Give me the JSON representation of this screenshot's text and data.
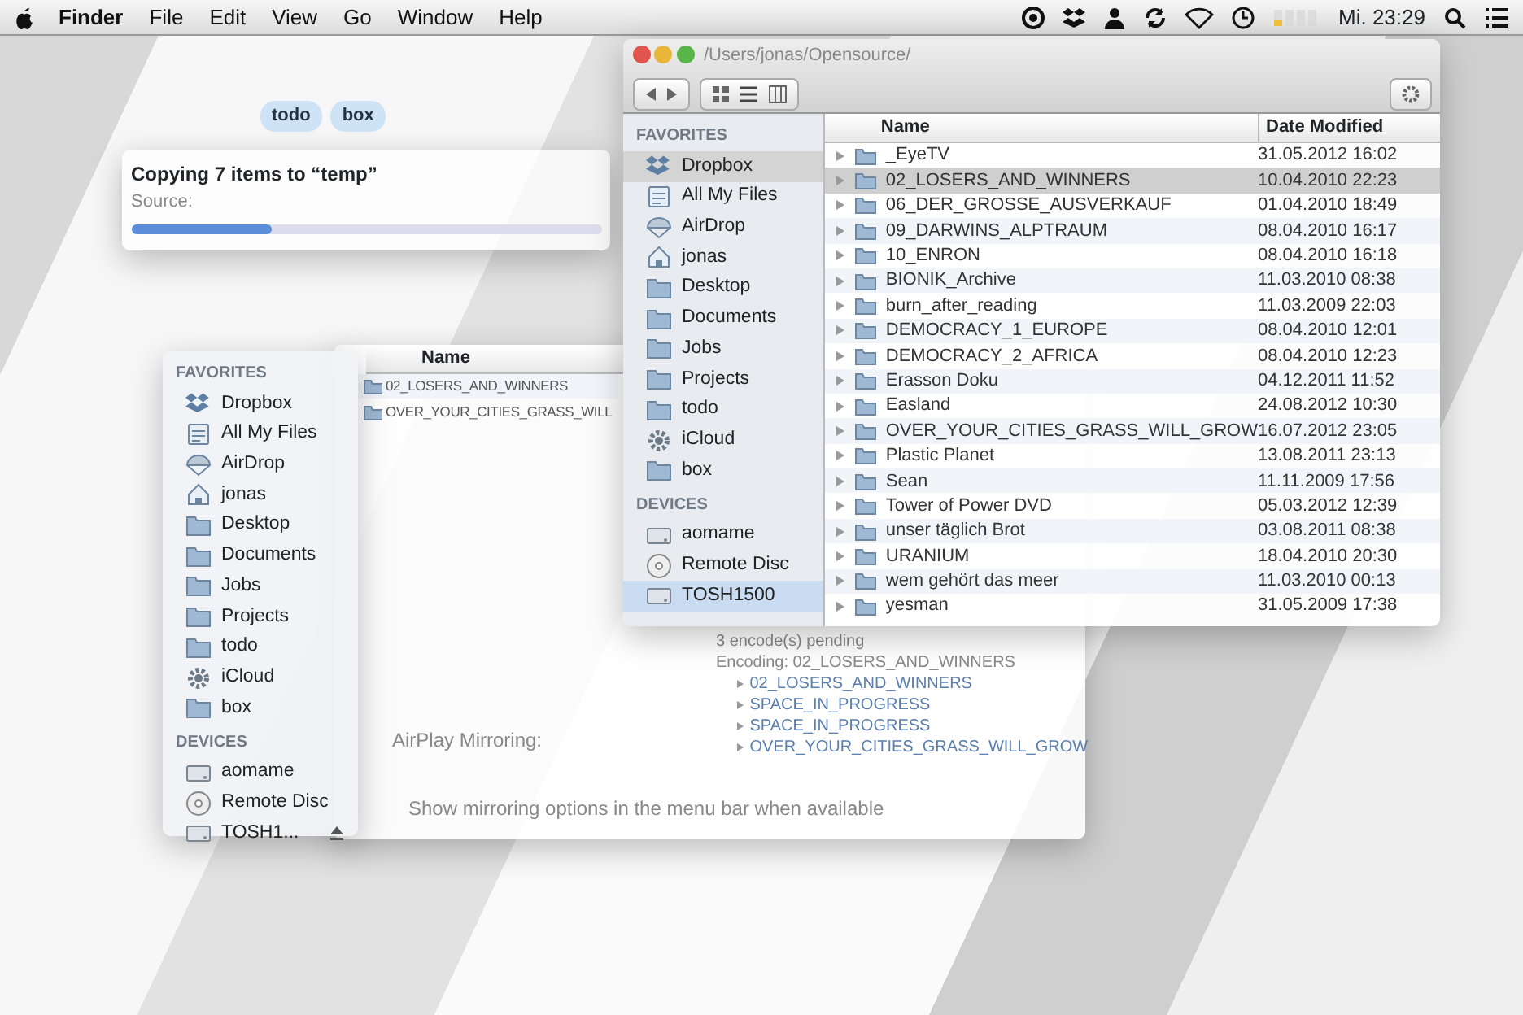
{
  "menu_bar": {
    "items": [
      {
        "label": "Finder",
        "kind": "app"
      },
      {
        "label": "File",
        "kind": "menu"
      },
      {
        "label": "Edit",
        "kind": "menu"
      },
      {
        "label": "View",
        "kind": "menu"
      },
      {
        "label": "Go",
        "kind": "menu"
      },
      {
        "label": "Window",
        "kind": "menu"
      },
      {
        "label": "Help",
        "kind": "menu"
      }
    ],
    "clock": "Mi. 23:29"
  },
  "copy_dialog": {
    "title": "Copying 7 items to “temp”",
    "source_label": "Source:",
    "level": 0.3
  },
  "tags": [
    "todo",
    "box"
  ],
  "left_finder": {
    "sections": [
      {
        "heading": "FAVORITES",
        "items": [
          {
            "label": "Dropbox",
            "kind": "dropbox",
            "selected": false
          },
          {
            "label": "All My Files",
            "kind": "files",
            "selected": false
          },
          {
            "label": "AirDrop",
            "kind": "airdrop",
            "selected": false
          },
          {
            "label": "jonas",
            "kind": "home",
            "selected": false
          },
          {
            "label": "Desktop",
            "kind": "folder",
            "selected": false
          },
          {
            "label": "Documents",
            "kind": "folder",
            "selected": false
          },
          {
            "label": "Jobs",
            "kind": "folder",
            "selected": false
          },
          {
            "label": "Projects",
            "kind": "folder",
            "selected": false
          },
          {
            "label": "todo",
            "kind": "folder",
            "selected": false
          },
          {
            "label": "iCloud",
            "kind": "cloud",
            "selected": false
          },
          {
            "label": "box",
            "kind": "folder",
            "selected": false
          }
        ]
      },
      {
        "heading": "DEVICES",
        "items": [
          {
            "label": "aomame",
            "kind": "disk",
            "selected": false
          },
          {
            "label": "Remote Disc",
            "kind": "disc",
            "selected": false
          },
          {
            "label": "TOSH1...",
            "kind": "ejectable",
            "selected": false
          }
        ]
      }
    ]
  },
  "middle_window": {
    "column": "Name",
    "rows": [
      "02_LOSERS_AND_WINNERS",
      "OVER_YOUR_CITIES_GRASS_WILL"
    ],
    "airplay_label": "AirPlay Mirroring:",
    "airplay_option": "Show mirroring options in the menu bar when available"
  },
  "queue": {
    "status": "3 encode(s) pending",
    "encoding": "Encoding: 02_LOSERS_AND_WINNERS",
    "items": [
      "02_LOSERS_AND_WINNERS",
      "SPACE_IN_PROGRESS",
      "SPACE_IN_PROGRESS",
      "OVER_YOUR_CITIES_GRASS_WILL_GROW"
    ]
  },
  "right_finder": {
    "path": "/Users/jonas/Opensource/",
    "sections": [
      {
        "heading": "FAVORITES",
        "items": [
          {
            "label": "Dropbox",
            "kind": "dropbox",
            "selected": true
          },
          {
            "label": "All My Files",
            "kind": "files",
            "selected": false
          },
          {
            "label": "AirDrop",
            "kind": "airdrop",
            "selected": false
          },
          {
            "label": "jonas",
            "kind": "home",
            "selected": false
          },
          {
            "label": "Desktop",
            "kind": "folder",
            "selected": false
          },
          {
            "label": "Documents",
            "kind": "folder",
            "selected": false
          },
          {
            "label": "Jobs",
            "kind": "folder",
            "selected": false
          },
          {
            "label": "Projects",
            "kind": "folder",
            "selected": false
          },
          {
            "label": "todo",
            "kind": "folder",
            "selected": false
          },
          {
            "label": "iCloud",
            "kind": "cloud",
            "selected": false
          },
          {
            "label": "box",
            "kind": "folder",
            "selected": false
          }
        ]
      },
      {
        "heading": "DEVICES",
        "items": [
          {
            "label": "aomame",
            "kind": "disk",
            "selected": false
          },
          {
            "label": "Remote Disc",
            "kind": "disc",
            "selected": false
          },
          {
            "label": "TOSH1500",
            "kind": "disk",
            "selected": true
          }
        ]
      }
    ],
    "columns": [
      "Name",
      "Date Modified"
    ],
    "rows": [
      {
        "name": "_EyeTV",
        "date": "31.05.2012 16:02",
        "selected": false
      },
      {
        "name": "02_LOSERS_AND_WINNERS",
        "date": "10.04.2010 22:23",
        "selected": true
      },
      {
        "name": "06_DER_GROSSE_AUSVERKAUF",
        "date": "01.04.2010 18:49",
        "selected": false
      },
      {
        "name": "09_DARWINS_ALPTRAUM",
        "date": "08.04.2010 16:17",
        "selected": false
      },
      {
        "name": "10_ENRON",
        "date": "08.04.2010 16:18",
        "selected": false
      },
      {
        "name": "BIONIK_Archive",
        "date": "11.03.2010 08:38",
        "selected": false
      },
      {
        "name": "burn_after_reading",
        "date": "11.03.2009 22:03",
        "selected": false
      },
      {
        "name": "DEMOCRACY_1_EUROPE",
        "date": "08.04.2010 12:01",
        "selected": false
      },
      {
        "name": "DEMOCRACY_2_AFRICA",
        "date": "08.04.2010 12:23",
        "selected": false
      },
      {
        "name": "Erasson Doku",
        "date": "04.12.2011 11:52",
        "selected": false
      },
      {
        "name": "Easland",
        "date": "24.08.2012 10:30",
        "selected": false
      },
      {
        "name": "OVER_YOUR_CITIES_GRASS_WILL_GROW",
        "date": "16.07.2012 23:05",
        "selected": false
      },
      {
        "name": "Plastic Planet",
        "date": "13.08.2011 23:13",
        "selected": false
      },
      {
        "name": "Sean",
        "date": "11.11.2009 17:56",
        "selected": false
      },
      {
        "name": "Tower of Power DVD",
        "date": "05.03.2012 12:39",
        "selected": false
      },
      {
        "name": "unser täglich Brot",
        "date": "03.08.2011 08:38",
        "selected": false
      },
      {
        "name": "URANIUM",
        "date": "18.04.2010 20:30",
        "selected": false
      },
      {
        "name": "wem gehört das meer",
        "date": "11.03.2010 00:13",
        "selected": false
      },
      {
        "name": "yesman",
        "date": "31.05.2009 17:38",
        "selected": false
      }
    ]
  }
}
